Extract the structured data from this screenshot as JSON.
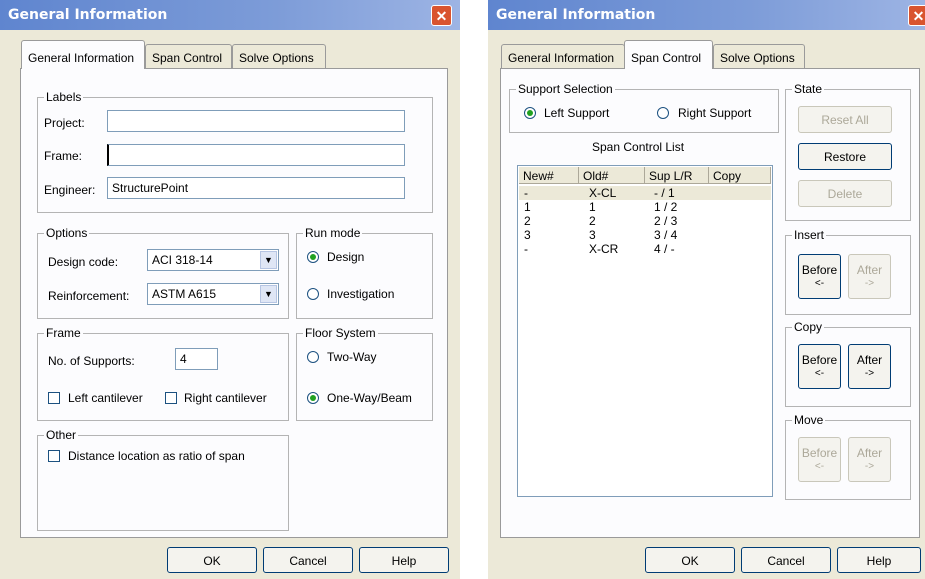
{
  "left": {
    "title": "General Information",
    "close": "✕",
    "tabs": [
      "General Information",
      "Span Control",
      "Solve Options"
    ],
    "labels_group": {
      "legend": "Labels",
      "project_label": "Project:",
      "project_value": "",
      "frame_label": "Frame:",
      "frame_value": "",
      "engineer_label": "Engineer:",
      "engineer_value": "StructurePoint"
    },
    "options_group": {
      "legend": "Options",
      "design_code_label": "Design code:",
      "design_code_value": "ACI 318-14",
      "reinforcement_label": "Reinforcement:",
      "reinforcement_value": "ASTM A615"
    },
    "run_mode": {
      "legend": "Run mode",
      "design": "Design",
      "investigation": "Investigation",
      "selected": "Design"
    },
    "frame_group": {
      "legend": "Frame",
      "supports_label": "No. of Supports:",
      "supports_value": "4",
      "left_cantilever": "Left cantilever",
      "right_cantilever": "Right cantilever"
    },
    "floor_system": {
      "legend": "Floor System",
      "two_way": "Two-Way",
      "one_way": "One-Way/Beam",
      "selected": "One-Way/Beam"
    },
    "other_group": {
      "legend": "Other",
      "distance_ratio": "Distance location as ratio of span"
    },
    "buttons": {
      "ok": "OK",
      "cancel": "Cancel",
      "help": "Help"
    }
  },
  "right": {
    "title": "General Information",
    "tabs": [
      "General Information",
      "Span Control",
      "Solve Options"
    ],
    "support_selection": {
      "legend": "Support Selection",
      "left": "Left Support",
      "right": "Right Support",
      "selected": "Left Support"
    },
    "span_list": {
      "title": "Span Control List",
      "columns": [
        "New#",
        "Old#",
        "Sup L/R",
        "Copy"
      ],
      "rows": [
        [
          "-",
          "X-CL",
          "- / 1",
          ""
        ],
        [
          "1",
          "1",
          "1 / 2",
          ""
        ],
        [
          "2",
          "2",
          "2 / 3",
          ""
        ],
        [
          "3",
          "3",
          "3 / 4",
          ""
        ],
        [
          "-",
          "X-CR",
          "4 / -",
          ""
        ]
      ]
    },
    "state": {
      "legend": "State",
      "reset_all": "Reset All",
      "restore": "Restore",
      "delete": "Delete"
    },
    "insert": {
      "legend": "Insert",
      "before": "Before",
      "before_arrow": "<-",
      "after": "After",
      "after_arrow": "->"
    },
    "copy": {
      "legend": "Copy",
      "before": "Before",
      "before_arrow": "<-",
      "after": "After",
      "after_arrow": "->"
    },
    "move": {
      "legend": "Move",
      "before": "Before",
      "before_arrow": "<-",
      "after": "After",
      "after_arrow": "->"
    },
    "buttons": {
      "ok": "OK",
      "cancel": "Cancel",
      "help": "Help"
    }
  }
}
